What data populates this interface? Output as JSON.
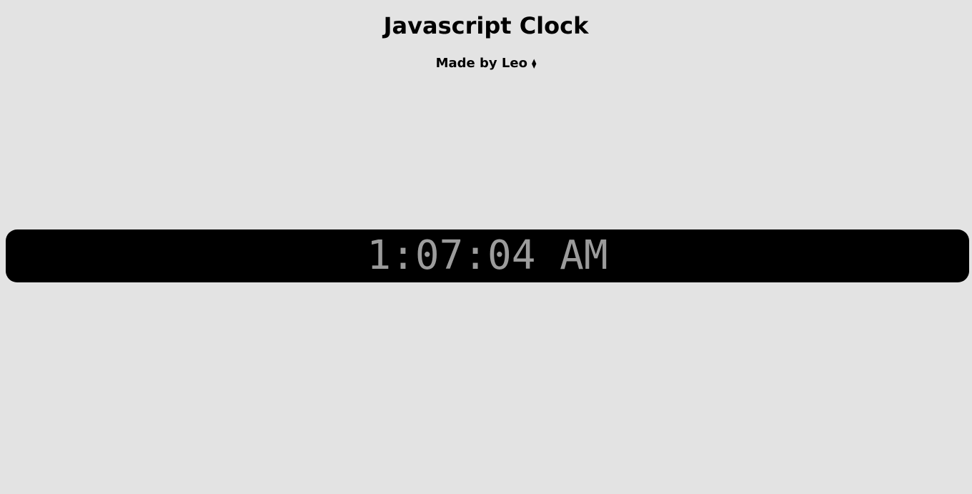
{
  "header": {
    "title": "Javascript Clock",
    "byline": "Made by Leo",
    "byline_symbol": "⧫"
  },
  "clock": {
    "time": "1:07:04 AM"
  },
  "colors": {
    "background": "#e3e3e3",
    "clock_bar": "#000000",
    "clock_text": "#9c9c9c"
  }
}
